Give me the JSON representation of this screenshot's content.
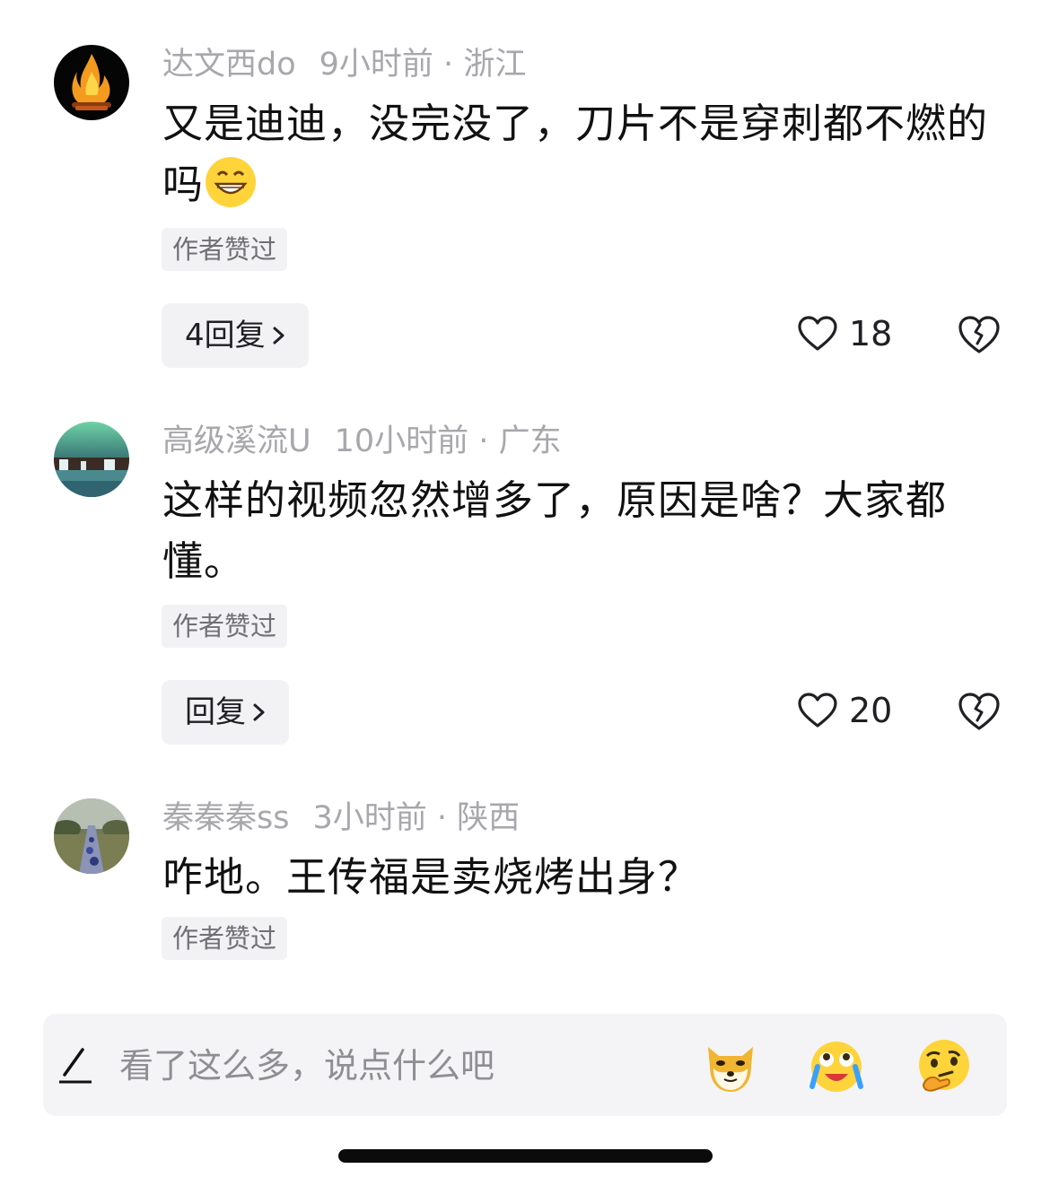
{
  "comments": [
    {
      "avatar_icon": "bonfire-avatar",
      "username": "达文西do",
      "time": "9小时前",
      "location": "浙江",
      "text": "又是迪迪，没完没了，刀片不是穿刺都不燃的吗",
      "inline_emoji": "grinning-face-emoji",
      "tag": "作者赞过",
      "reply_label": "4回复",
      "likes": "18"
    },
    {
      "avatar_icon": "aurora-waterfall-avatar",
      "username": "高级溪流U",
      "time": "10小时前",
      "location": "广东",
      "text": "这样的视频忽然增多了，原因是啥？大家都懂。",
      "tag": "作者赞过",
      "reply_label": "回复",
      "likes": "20"
    },
    {
      "avatar_icon": "park-path-avatar",
      "username": "秦秦秦ss",
      "time": "3小时前",
      "location": "陕西",
      "text": "咋地。王传福是卖烧烤出身？",
      "tag": "作者赞过"
    }
  ],
  "separator": " · ",
  "input": {
    "placeholder": "看了这么多，说点什么吧",
    "pen_icon": "pen-icon",
    "stickers": [
      "shiba-dog-sticker",
      "crying-laugh-sticker",
      "thinking-face-sticker"
    ]
  },
  "colors": {
    "meta": "#a7a7ac",
    "text": "#111111",
    "tag_bg": "#f2f2f4"
  }
}
